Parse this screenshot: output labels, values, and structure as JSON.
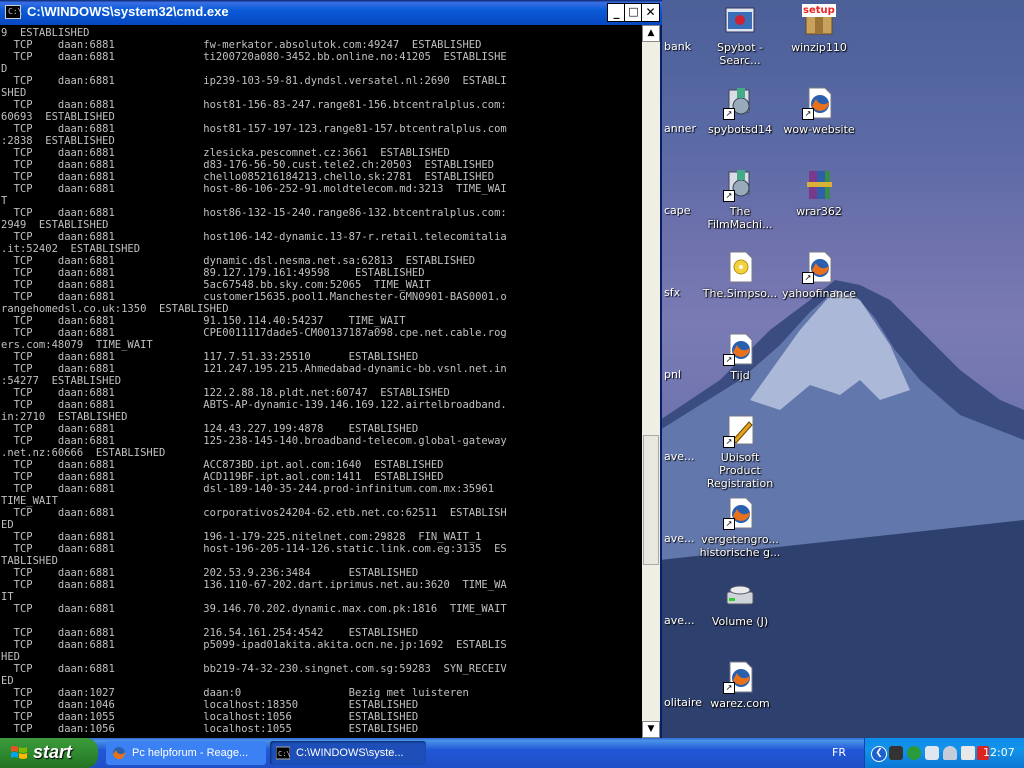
{
  "window": {
    "title": "C:\\WINDOWS\\system32\\cmd.exe",
    "minimize_label": "_",
    "maximize_label": "□",
    "close_label": "✕",
    "icon_text": "C:\\"
  },
  "console": {
    "lines": [
      "9  ESTABLISHED",
      "  TCP    daan:6881              fw-merkator.absolutok.com:49247  ESTABLISHED",
      "  TCP    daan:6881              ti200720a080-3452.bb.online.no:41205  ESTABLISHE",
      "D",
      "  TCP    daan:6881              ip239-103-59-81.dyndsl.versatel.nl:2690  ESTABLI",
      "SHED",
      "  TCP    daan:6881              host81-156-83-247.range81-156.btcentralplus.com:",
      "60693  ESTABLISHED",
      "  TCP    daan:6881              host81-157-197-123.range81-157.btcentralplus.com",
      ":2838  ESTABLISHED",
      "  TCP    daan:6881              zlesicka.pescomnet.cz:3661  ESTABLISHED",
      "  TCP    daan:6881              d83-176-56-50.cust.tele2.ch:20503  ESTABLISHED",
      "  TCP    daan:6881              chello085216184213.chello.sk:2781  ESTABLISHED",
      "  TCP    daan:6881              host-86-106-252-91.moldtelecom.md:3213  TIME_WAI",
      "T",
      "  TCP    daan:6881              host86-132-15-240.range86-132.btcentralplus.com:",
      "2949  ESTABLISHED",
      "  TCP    daan:6881              host106-142-dynamic.13-87-r.retail.telecomitalia",
      ".it:52402  ESTABLISHED",
      "  TCP    daan:6881              dynamic.dsl.nesma.net.sa:62813  ESTABLISHED",
      "  TCP    daan:6881              89.127.179.161:49598    ESTABLISHED",
      "  TCP    daan:6881              5ac67548.bb.sky.com:52065  TIME_WAIT",
      "  TCP    daan:6881              customer15635.pool1.Manchester-GMN0901-BAS0001.o",
      "rangehomedsl.co.uk:1350  ESTABLISHED",
      "  TCP    daan:6881              91.150.114.40:54237    TIME_WAIT",
      "  TCP    daan:6881              CPE0011117dade5-CM00137187a098.cpe.net.cable.rog",
      "ers.com:48079  TIME_WAIT",
      "  TCP    daan:6881              117.7.51.33:25510      ESTABLISHED",
      "  TCP    daan:6881              121.247.195.215.Ahmedabad-dynamic-bb.vsnl.net.in",
      ":54277  ESTABLISHED",
      "  TCP    daan:6881              122.2.88.18.pldt.net:60747  ESTABLISHED",
      "  TCP    daan:6881              ABTS-AP-dynamic-139.146.169.122.airtelbroadband.",
      "in:2710  ESTABLISHED",
      "  TCP    daan:6881              124.43.227.199:4878    ESTABLISHED",
      "  TCP    daan:6881              125-238-145-140.broadband-telecom.global-gateway",
      ".net.nz:60666  ESTABLISHED",
      "  TCP    daan:6881              ACC873BD.ipt.aol.com:1640  ESTABLISHED",
      "  TCP    daan:6881              ACD119BF.ipt.aol.com:1411  ESTABLISHED",
      "  TCP    daan:6881              dsl-189-140-35-244.prod-infinitum.com.mx:35961",
      "TIME_WAIT",
      "  TCP    daan:6881              corporativos24204-62.etb.net.co:62511  ESTABLISH",
      "ED",
      "  TCP    daan:6881              196-1-179-225.nitelnet.com:29828  FIN_WAIT_1",
      "  TCP    daan:6881              host-196-205-114-126.static.link.com.eg:3135  ES",
      "TABLISHED",
      "  TCP    daan:6881              202.53.9.236:3484      ESTABLISHED",
      "  TCP    daan:6881              136.110-67-202.dart.iprimus.net.au:3620  TIME_WA",
      "IT",
      "  TCP    daan:6881              39.146.70.202.dynamic.max.com.pk:1816  TIME_WAIT",
      "",
      "  TCP    daan:6881              216.54.161.254:4542    ESTABLISHED",
      "  TCP    daan:6881              p5099-ipad01akita.akita.ocn.ne.jp:1692  ESTABLIS",
      "HED",
      "  TCP    daan:6881              bb219-74-32-230.singnet.com.sg:59283  SYN_RECEIV",
      "ED",
      "  TCP    daan:1027              daan:0                 Bezig met luisteren",
      "  TCP    daan:1046              localhost:18350        ESTABLISHED",
      "  TCP    daan:1055              localhost:1056         ESTABLISHED",
      "  TCP    daan:1056              localhost:1055         ESTABLISHED"
    ]
  },
  "desktop": {
    "icons": [
      {
        "label": "Spybot - Searc...",
        "icon": "spybot-icon"
      },
      {
        "label": "winzip110",
        "icon": "winzip-setup-icon",
        "badge": "setup"
      },
      {
        "label": "spybotsd14",
        "icon": "installer-icon"
      },
      {
        "label": "wow-website",
        "icon": "firefox-icon"
      },
      {
        "label": "The FilmMachi...",
        "icon": "installer-icon"
      },
      {
        "label": "wrar362",
        "icon": "winrar-icon"
      },
      {
        "label": "The.Simpso...",
        "icon": "media-file-icon"
      },
      {
        "label": "yahoofinance",
        "icon": "firefox-icon"
      },
      {
        "label": "Tijd",
        "icon": "firefox-icon"
      },
      {
        "label": "Ubisoft Product Registration",
        "icon": "ubisoft-icon"
      },
      {
        "label": "vergetengro... historische g...",
        "icon": "firefox-icon"
      },
      {
        "label": "Volume (J)",
        "icon": "drive-icon"
      },
      {
        "label": "warez.com",
        "icon": "firefox-icon"
      }
    ],
    "partial_labels": [
      "bank",
      "anner",
      "cape",
      "sfx",
      "pnl",
      "ave...",
      "ave...",
      "ave...",
      "olitaire"
    ]
  },
  "taskbar": {
    "start_label": "start",
    "tasks": [
      {
        "label": "Pc helpforum - Reage...",
        "icon": "firefox-icon"
      },
      {
        "label": "C:\\WINDOWS\\syste...",
        "icon": "cmd-icon"
      }
    ],
    "language": "FR",
    "clock": "12:07"
  },
  "colors": {
    "console_bg": "#000000",
    "console_fg": "#c0c0c0",
    "titlebar": "#0a5bd8",
    "taskbar": "#2157d7",
    "start": "#2f8a2f"
  }
}
